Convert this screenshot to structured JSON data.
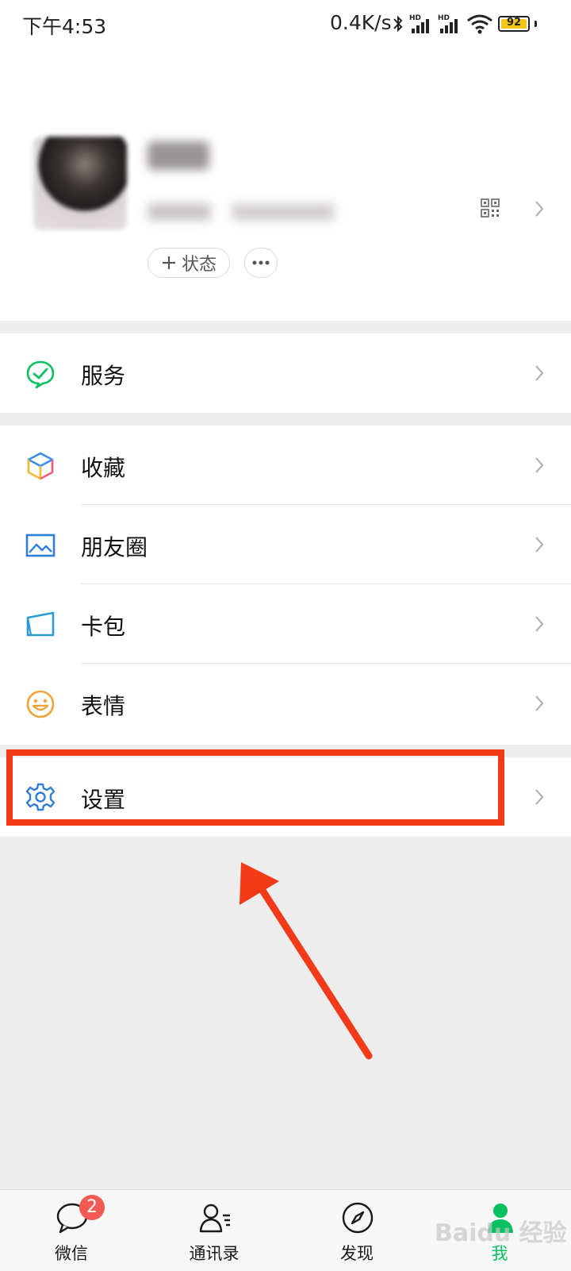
{
  "status_bar": {
    "time": "下午4:53",
    "speed": "0.4K/s",
    "battery": "92"
  },
  "profile": {
    "status_label": "状态"
  },
  "groups": {
    "services": {
      "label": "服务"
    },
    "favorites": {
      "label": "收藏"
    },
    "moments": {
      "label": "朋友圈"
    },
    "cards": {
      "label": "卡包"
    },
    "stickers": {
      "label": "表情"
    },
    "settings": {
      "label": "设置"
    }
  },
  "tabbar": {
    "chats": {
      "label": "微信",
      "badge": "2"
    },
    "contacts": {
      "label": "通讯录"
    },
    "discover": {
      "label": "发现"
    },
    "me": {
      "label": "我"
    }
  },
  "watermark": "Baidu 经验",
  "colors": {
    "accent_green": "#07c160",
    "annotation_red": "#f23a18",
    "badge_red": "#f25a53"
  }
}
